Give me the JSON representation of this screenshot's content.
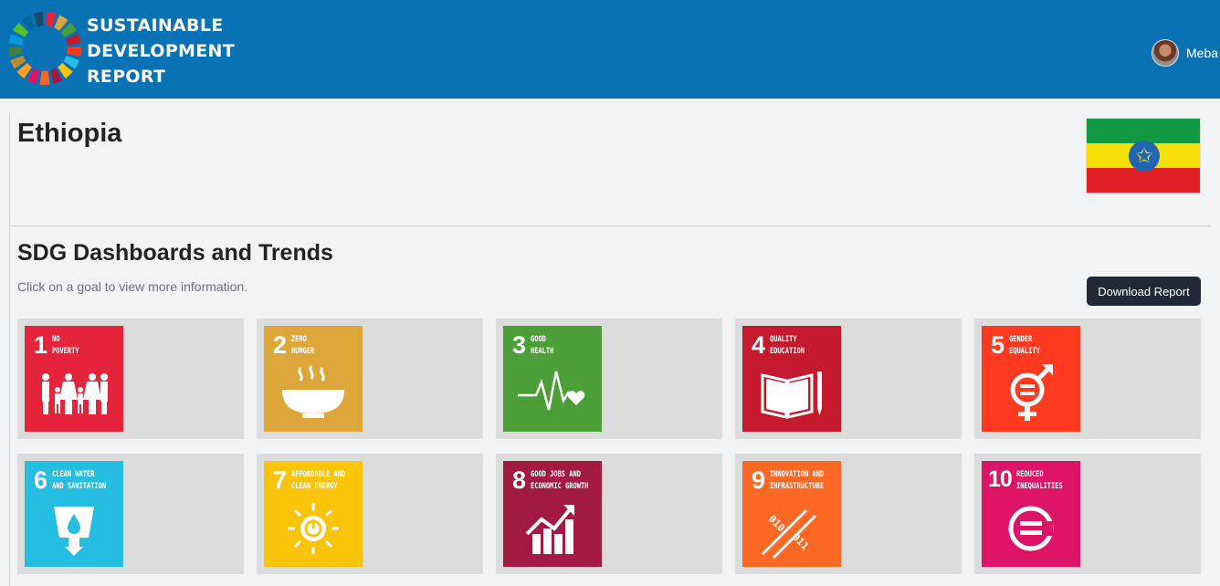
{
  "header": {
    "logo_lines": [
      "SUSTAINABLE",
      "DEVELOPMENT",
      "REPORT"
    ],
    "user_name": "Meba",
    "brand_color": "#0872b4"
  },
  "country": {
    "name": "Ethiopia",
    "flag_icon": "ethiopia-flag"
  },
  "section": {
    "title": "SDG Dashboards and Trends",
    "hint": "Click on a goal to view more information.",
    "download_label": "Download Report"
  },
  "goals": [
    {
      "number": "1",
      "label_1": "NO",
      "label_2": "POVERTY",
      "color": "#e5243b",
      "icon": "family-icon"
    },
    {
      "number": "2",
      "label_1": "ZERO",
      "label_2": "HUNGER",
      "color": "#dda63a",
      "icon": "bowl-icon"
    },
    {
      "number": "3",
      "label_1": "GOOD",
      "label_2": "HEALTH",
      "color": "#4c9f38",
      "icon": "heartbeat-icon"
    },
    {
      "number": "4",
      "label_1": "QUALITY",
      "label_2": "EDUCATION",
      "color": "#c5192d",
      "icon": "book-icon"
    },
    {
      "number": "5",
      "label_1": "GENDER",
      "label_2": "EQUALITY",
      "color": "#ff3a21",
      "icon": "gender-icon"
    },
    {
      "number": "6",
      "label_1": "CLEAN WATER",
      "label_2": "AND SANITATION",
      "color": "#26bde2",
      "icon": "water-icon"
    },
    {
      "number": "7",
      "label_1": "AFFORDABLE AND",
      "label_2": "CLEAN ENERGY",
      "color": "#fcc30b",
      "icon": "sun-power-icon"
    },
    {
      "number": "8",
      "label_1": "GOOD JOBS AND",
      "label_2": "ECONOMIC GROWTH",
      "color": "#a21942",
      "icon": "growth-chart-icon"
    },
    {
      "number": "9",
      "label_1": "INNOVATION AND",
      "label_2": "INFRASTRUCTURE",
      "color": "#fd6925",
      "icon": "binary-icon"
    },
    {
      "number": "10",
      "label_1": "REDUCED",
      "label_2": "INEQUALITIES",
      "color": "#dd1367",
      "icon": "equal-icon"
    }
  ]
}
